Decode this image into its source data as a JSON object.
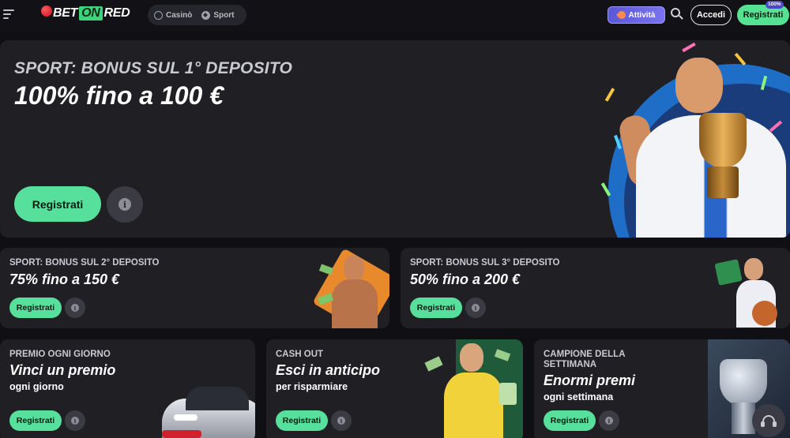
{
  "header": {
    "menu_icon": "hamburger-menu-icon",
    "logo": {
      "part1": "BET",
      "part2": "ON",
      "part3": "RED"
    },
    "nav": [
      {
        "label": "Casinò",
        "icon": "casino-chip-icon"
      },
      {
        "label": "Sport",
        "icon": "soccer-ball-icon"
      }
    ],
    "activity_label": "Attività",
    "login_label": "Accedi",
    "register_label": "Registrati",
    "progress_badge": "100%"
  },
  "hero": {
    "subtitle": "SPORT: BONUS SUL 1° DEPOSITO",
    "title": "100% fino a 100 €",
    "register_label": "Registrati",
    "info_label": "i"
  },
  "promos": [
    {
      "subtitle": "SPORT: BONUS SUL 2° DEPOSITO",
      "title": "75% fino a 150 €",
      "register_label": "Registrati",
      "info_label": "i"
    },
    {
      "subtitle": "SPORT: BONUS SUL 3° DEPOSITO",
      "title": "50% fino a 200 €",
      "register_label": "Registrati",
      "info_label": "i"
    }
  ],
  "features": [
    {
      "subtitle": "PREMIO OGNI GIORNO",
      "title": "Vinci un premio",
      "description": "ogni giorno",
      "register_label": "Registrati",
      "info_label": "i"
    },
    {
      "subtitle": "CASH OUT",
      "title": "Esci in anticipo",
      "description": "per risparmiare",
      "register_label": "Registrati",
      "info_label": "i"
    },
    {
      "subtitle_line1": "CAMPIONE DELLA",
      "subtitle_line2": "SETTIMANA",
      "title": "Enormi premi",
      "description": "ogni settimana",
      "register_label": "Registrati",
      "info_label": "i"
    }
  ],
  "colors": {
    "background": "#101014",
    "card": "#1f1f24",
    "accent_green": "#57e09b",
    "accent_purple": "#6a66e6"
  },
  "support_icon": "headset-icon"
}
